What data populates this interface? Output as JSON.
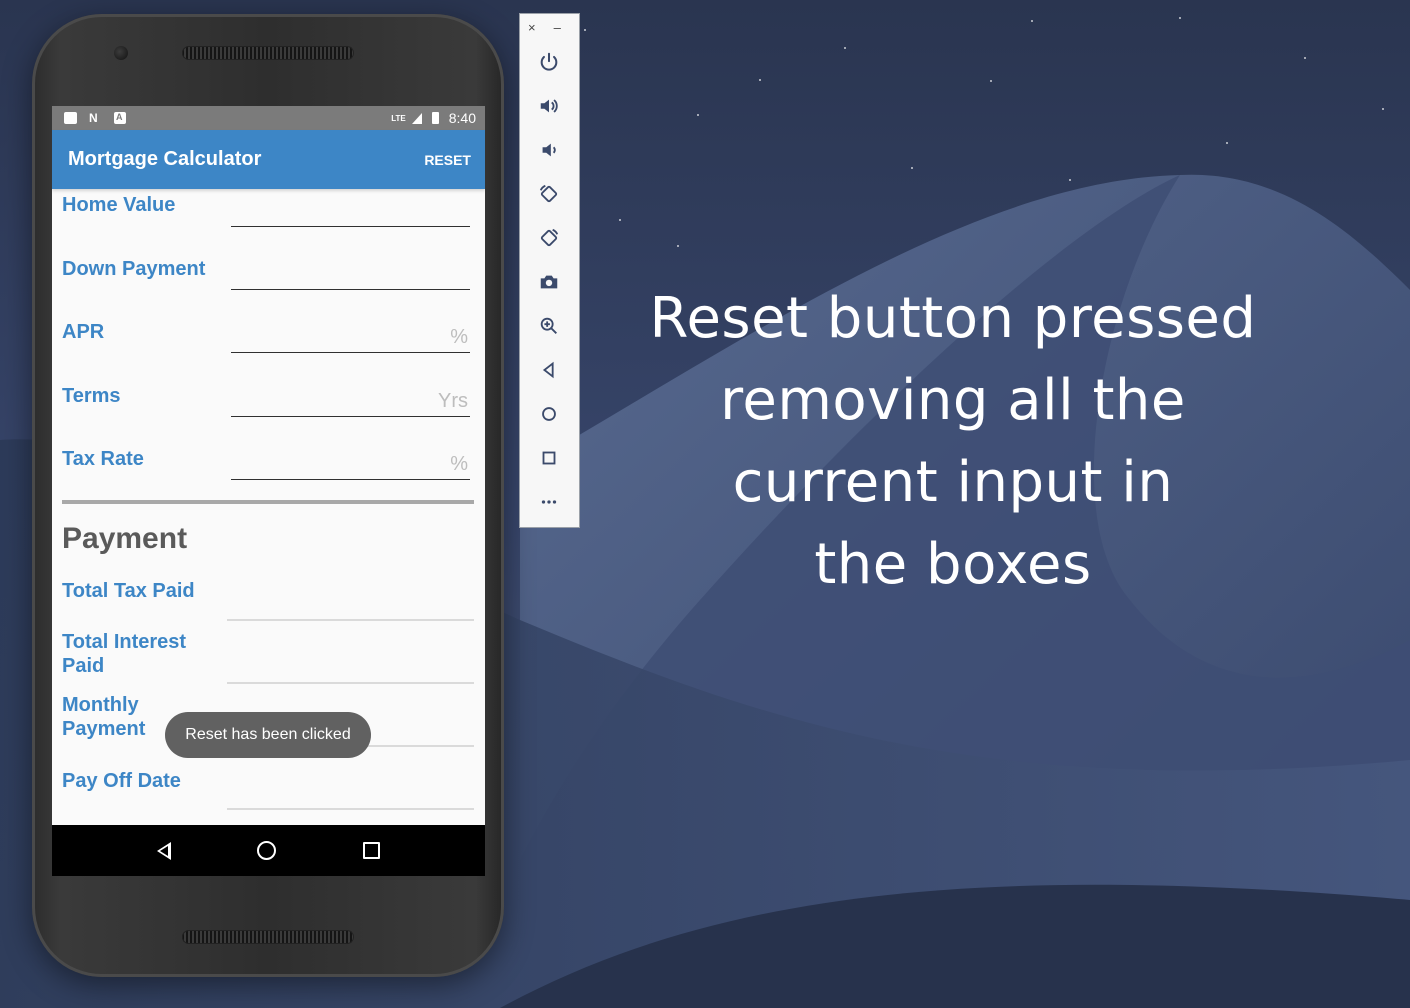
{
  "caption": [
    "Reset button pressed",
    "removing all the",
    "current input in",
    "the boxes"
  ],
  "status_bar": {
    "network": "LTE",
    "time": "8:40"
  },
  "app_bar": {
    "title": "Mortgage Calculator",
    "reset_label": "RESET"
  },
  "form": {
    "fields": [
      {
        "label": "Home Value",
        "value": "",
        "placeholder": ""
      },
      {
        "label": "Down Payment",
        "value": "",
        "placeholder": ""
      },
      {
        "label": "APR",
        "value": "",
        "placeholder": "%"
      },
      {
        "label": "Terms",
        "value": "",
        "placeholder": "Yrs"
      },
      {
        "label": "Tax Rate",
        "value": "",
        "placeholder": "%"
      }
    ]
  },
  "payment": {
    "title": "Payment",
    "outputs": [
      {
        "label": "Total Tax Paid",
        "value": ""
      },
      {
        "label": "Total Interest Paid",
        "value": ""
      },
      {
        "label": "Monthly Payment",
        "value": ""
      },
      {
        "label": "Pay Off Date",
        "value": ""
      }
    ]
  },
  "toast": "Reset has been clicked",
  "emulator_toolbar": {
    "window_controls": [
      "×",
      "–"
    ],
    "buttons": [
      "power-icon",
      "volume-up-icon",
      "volume-down-icon",
      "rotate-left-icon",
      "rotate-right-icon",
      "camera-icon",
      "zoom-icon",
      "back-icon",
      "home-icon",
      "overview-icon",
      "more-icon"
    ]
  },
  "colors": {
    "accent": "#3d86c6",
    "status_bar": "#7b7b7b",
    "toast": "#616161"
  }
}
